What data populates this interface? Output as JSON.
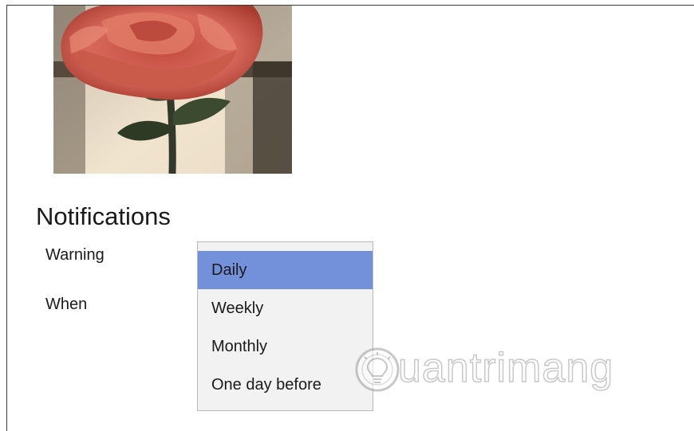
{
  "section": {
    "title": "Notifications"
  },
  "fields": {
    "warning_label": "Warning",
    "when_label": "When"
  },
  "dropdown": {
    "options": [
      "Daily",
      "Weekly",
      "Monthly",
      "One day before"
    ],
    "selected_index": 0
  },
  "watermark": {
    "text": "uantrimang",
    "icon": "lightbulb-icon"
  },
  "colors": {
    "selected_item": "#7390da",
    "dropdown_bg": "#f2f2f2",
    "text": "#1a1a1a",
    "frame": "#3a3a3a"
  }
}
